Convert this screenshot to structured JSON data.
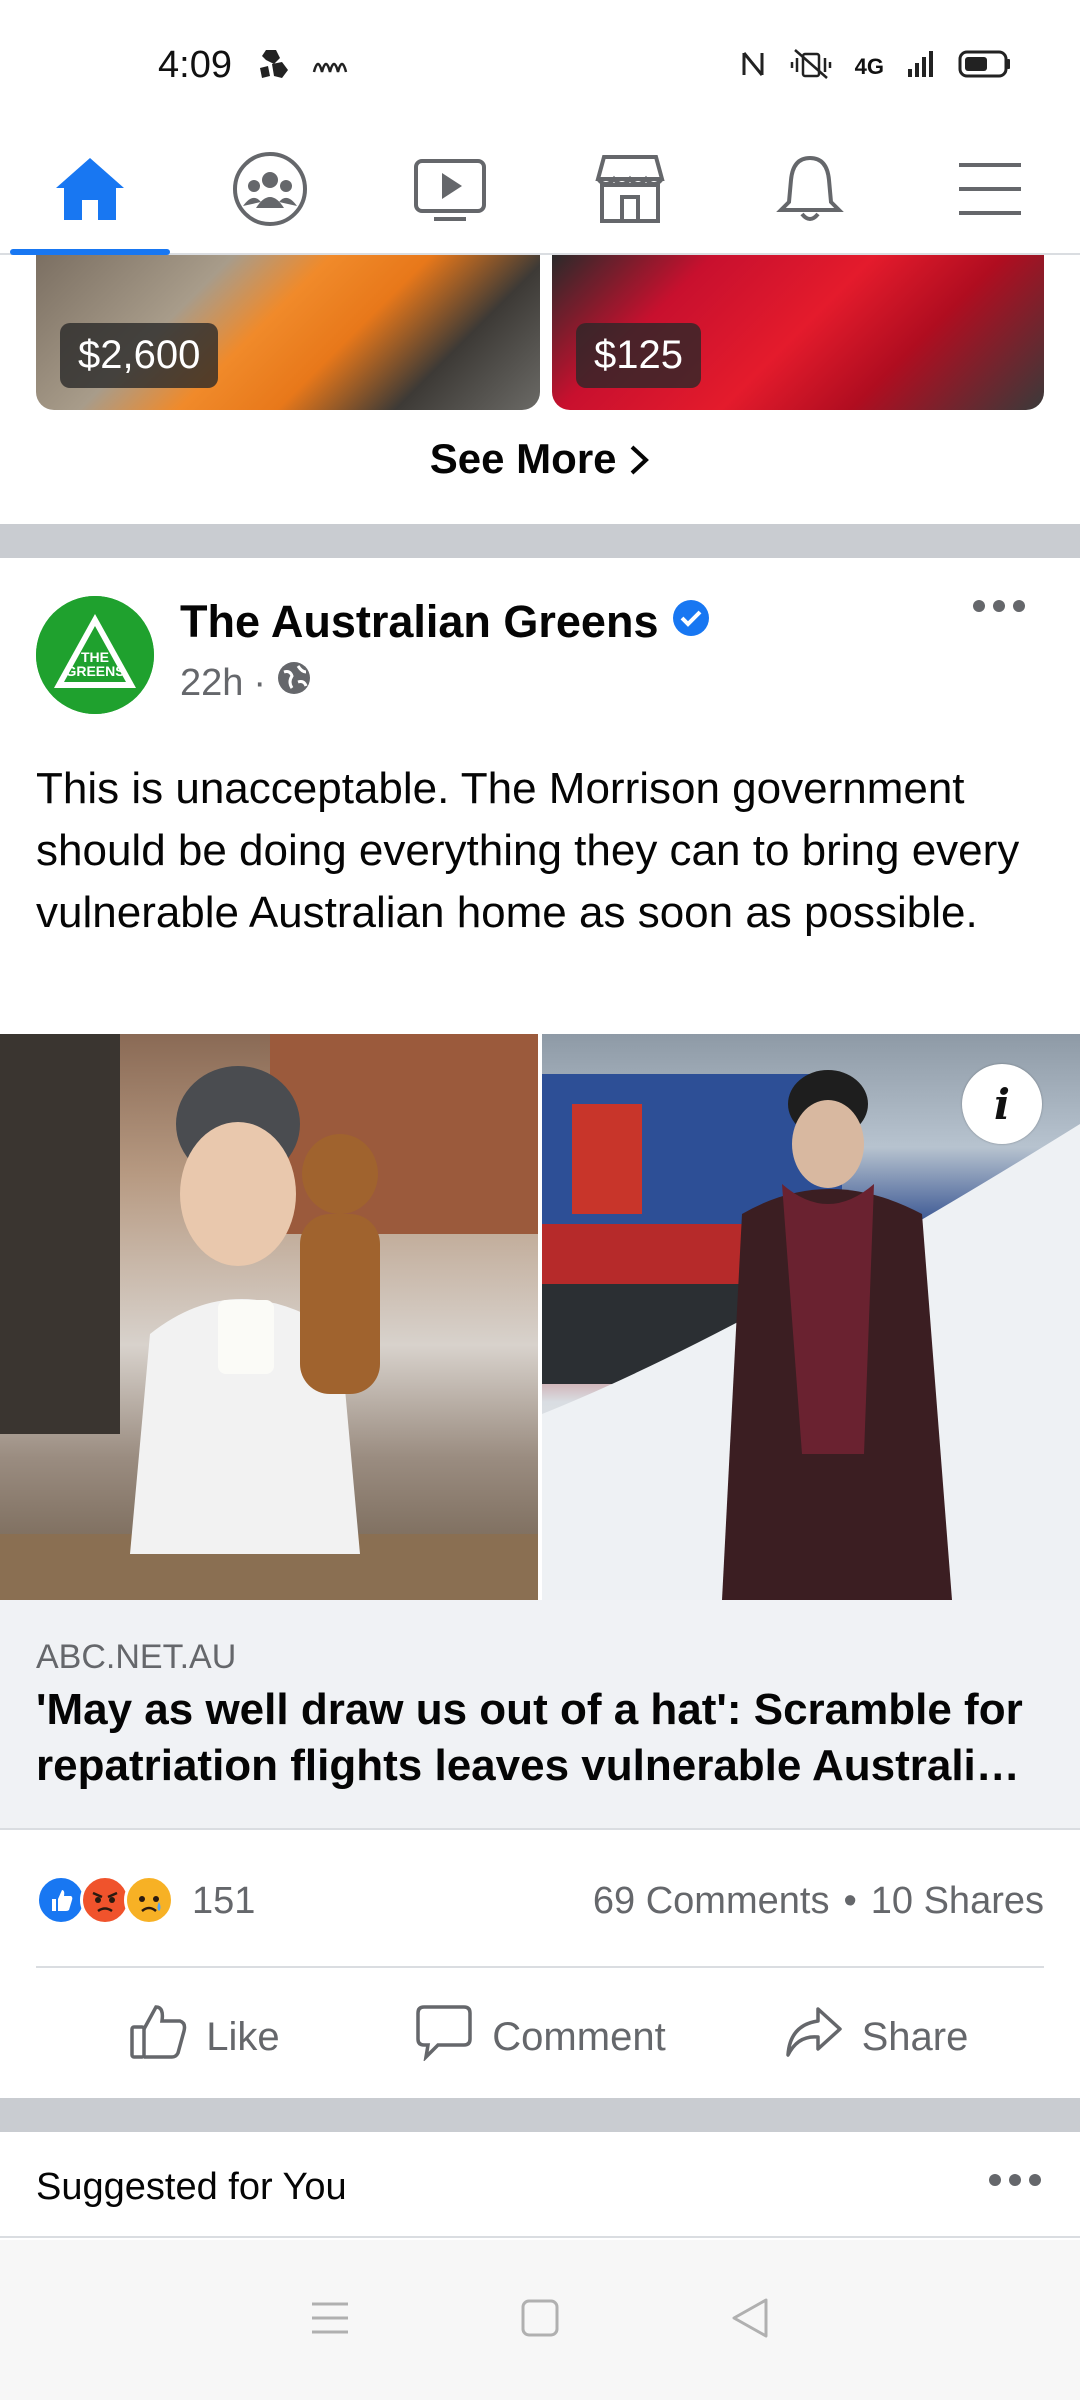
{
  "status_bar": {
    "time": "4:09",
    "network": "4G",
    "icons": [
      "hexagon-app-icon",
      "signal-waves-icon",
      "nfc-icon",
      "vibrate-mute-icon",
      "cellular-signal-icon",
      "battery-icon"
    ]
  },
  "top_nav": {
    "tabs": [
      {
        "name": "home",
        "icon": "home-icon",
        "active": true
      },
      {
        "name": "groups",
        "icon": "groups-icon",
        "active": false
      },
      {
        "name": "watch",
        "icon": "video-play-icon",
        "active": false
      },
      {
        "name": "marketplace",
        "icon": "marketplace-store-icon",
        "active": false
      },
      {
        "name": "notifications",
        "icon": "bell-icon",
        "active": false
      },
      {
        "name": "menu",
        "icon": "hamburger-menu-icon",
        "active": false
      }
    ],
    "accent": "#1877f2"
  },
  "marketplace": {
    "items": [
      {
        "price": "$2,600"
      },
      {
        "price": "$125"
      }
    ],
    "see_more": "See More"
  },
  "post": {
    "author": "The Australian Greens",
    "avatar_text": "THE GREENS",
    "time": "22h",
    "separator": "·",
    "verified": true,
    "privacy_icon": "globe-icon",
    "text": "This is unacceptable. The Morrison government should be doing everything they can to bring every vulnerable Australian home as soon as possible.",
    "link": {
      "domain": "ABC.NET.AU",
      "title": "'May as well draw us out of a hat': Scramble for repatriation flights leaves vulnerable Australi…"
    },
    "info_label": "i",
    "reaction_count": "151",
    "comments": "69 Comments",
    "dot": "•",
    "shares": "10 Shares",
    "actions": {
      "like": "Like",
      "comment": "Comment",
      "share": "Share"
    }
  },
  "suggested": {
    "label": "Suggested for You"
  },
  "colors": {
    "brand_blue": "#1877f2",
    "greens_green": "#1fa12e",
    "divider": "#c9ccd1",
    "secondary_text": "#65676b"
  }
}
